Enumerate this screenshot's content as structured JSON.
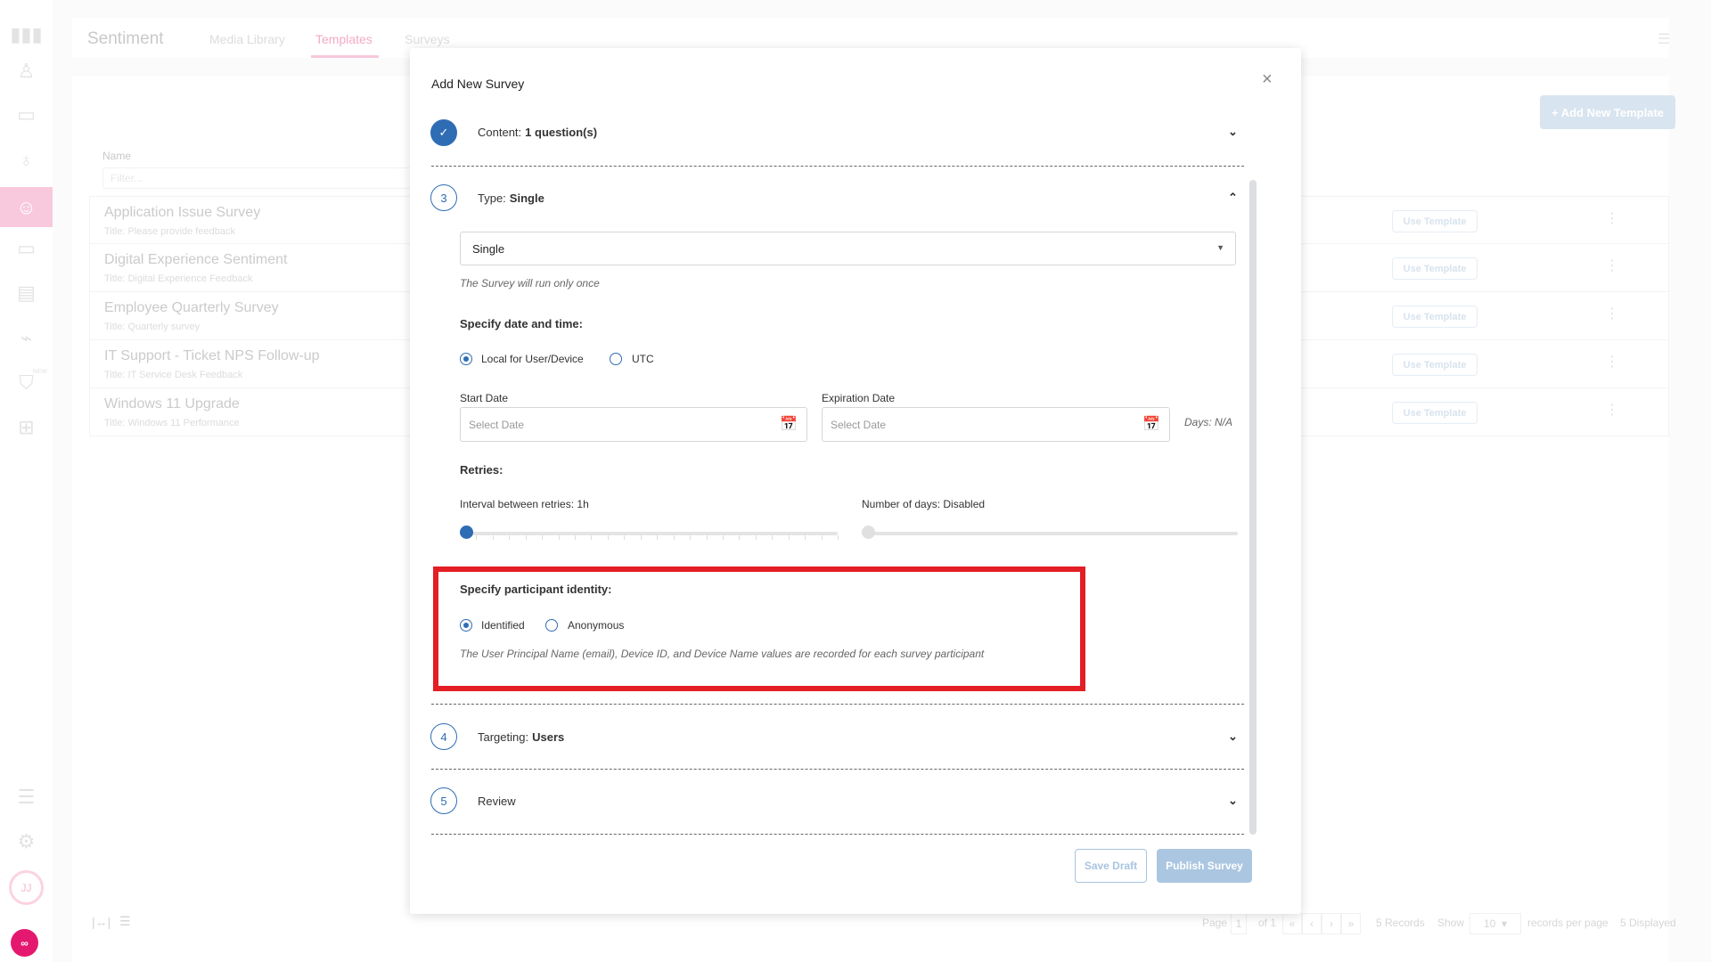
{
  "sidebar": {
    "items": [
      {
        "icon": "bar-chart-icon",
        "glyph": "▮"
      },
      {
        "icon": "user-icon",
        "glyph": "👤"
      },
      {
        "icon": "laptop-icon",
        "glyph": "💻"
      },
      {
        "icon": "microphone-icon",
        "glyph": "🎙"
      },
      {
        "icon": "smiley-icon",
        "glyph": "☺"
      },
      {
        "icon": "user-screen-icon",
        "glyph": "▭"
      },
      {
        "icon": "report-icon",
        "glyph": "▤"
      },
      {
        "icon": "monitor-pulse-icon",
        "glyph": "🖵"
      },
      {
        "icon": "shield-icon",
        "glyph": "⛉",
        "badge": "NEW"
      },
      {
        "icon": "apps-add-icon",
        "glyph": "⊞"
      },
      {
        "icon": "list-document-icon",
        "glyph": "☰"
      },
      {
        "icon": "gear-icon",
        "glyph": "⚙"
      }
    ],
    "avatar": "JJ",
    "logo": "oo"
  },
  "header": {
    "title": "Sentiment",
    "tabs": [
      {
        "label": "Media Library"
      },
      {
        "label": "Templates",
        "active": true
      },
      {
        "label": "Surveys"
      }
    ]
  },
  "main": {
    "add_button": "+ Add New Template",
    "column_name": "Name",
    "filter_placeholder": "Filter...",
    "rows": [
      {
        "name": "Application Issue Survey",
        "subtitle": "Title: Please provide feedback",
        "action": "Use Template"
      },
      {
        "name": "Digital Experience Sentiment",
        "subtitle": "Title: Digital Experience Feedback",
        "action": "Use Template"
      },
      {
        "name": "Employee Quarterly Survey",
        "subtitle": "Title: Quarterly survey",
        "action": "Use Template"
      },
      {
        "name": "IT Support - Ticket NPS Follow-up",
        "subtitle": "Title: IT Service Desk Feedback",
        "action": "Use Template"
      },
      {
        "name": "Windows 11 Upgrade",
        "subtitle": "Title: Windows 11 Performance",
        "action": "Use Template"
      }
    ],
    "pagination": {
      "page_label": "Page",
      "page": "1",
      "of": "of 1",
      "first": "«",
      "prev": "‹",
      "next": "›",
      "last": "»",
      "records": "5 Records",
      "show": "Show",
      "per_page": "10",
      "per_page_label": "records per page",
      "displayed": "5 Displayed"
    }
  },
  "modal": {
    "title": "Add New Survey",
    "close": "×",
    "steps": [
      {
        "number": "✓",
        "label": "Content:",
        "value": "1 question(s)",
        "state": "complete",
        "expanded": false
      },
      {
        "number": "3",
        "label": "Type:",
        "value": "Single",
        "expanded": true
      },
      {
        "number": "4",
        "label": "Targeting:",
        "value": "Users",
        "expanded": false
      },
      {
        "number": "5",
        "label": "Review",
        "value": "",
        "expanded": false
      }
    ],
    "type": {
      "selected": "Single",
      "hint": "The Survey will run only once"
    },
    "datetime": {
      "heading": "Specify date and time:",
      "options": [
        "Local for User/Device",
        "UTC"
      ],
      "selected": "Local for User/Device",
      "start_label": "Start Date",
      "expiration_label": "Expiration Date",
      "placeholder": "Select Date",
      "days": "Days: N/A"
    },
    "retries": {
      "heading": "Retries:",
      "interval_label": "Interval between retries: 1h",
      "interval_value": 0,
      "days_label": "Number of days: Disabled",
      "days_value": 0,
      "days_enabled": false
    },
    "identity": {
      "heading": "Specify participant identity:",
      "options": [
        "Identified",
        "Anonymous"
      ],
      "selected": "Identified",
      "hint": "The User Principal Name (email), Device ID, and Device Name values are recorded for each survey participant"
    },
    "save_draft": "Save Draft",
    "publish": "Publish Survey"
  },
  "colors": {
    "accent": "#2e6db4",
    "brand": "#e5186f",
    "highlight": "#e31e24"
  }
}
